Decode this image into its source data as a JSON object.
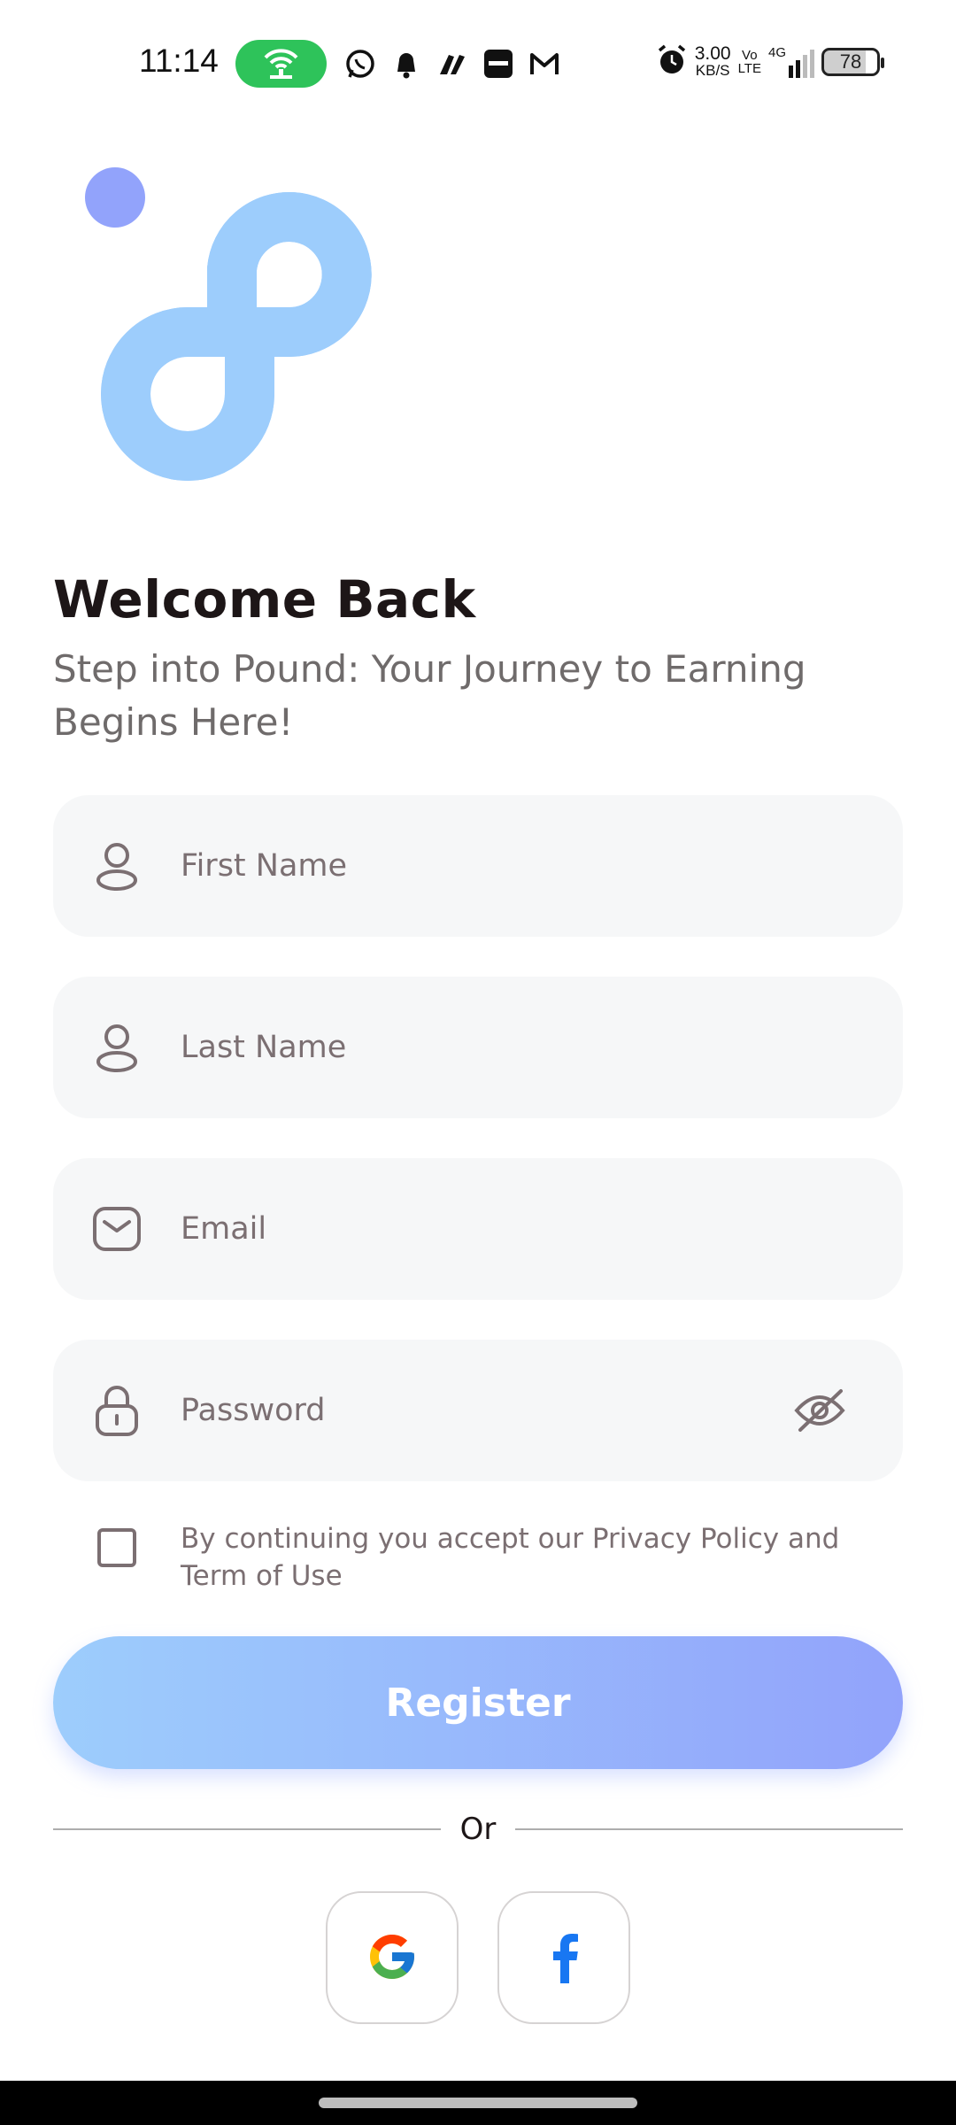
{
  "status_bar": {
    "time": "11:14",
    "net_speed_value": "3.00",
    "net_speed_unit": "KB/S",
    "volte_top": "Vo",
    "volte_bottom": "LTE",
    "network": "4G",
    "battery": "78",
    "icons": [
      "hotspot-icon",
      "whatsapp-icon",
      "bell-icon",
      "phonepe-icon",
      "paytm-icon",
      "gmail-icon",
      "alarm-icon",
      "signal-icon"
    ]
  },
  "header": {
    "title": "Welcome Back",
    "subtitle": "Step into Pound: Your Journey to Earning Begins Here!"
  },
  "form": {
    "first_name": {
      "placeholder": "First Name",
      "value": ""
    },
    "last_name": {
      "placeholder": "Last Name",
      "value": ""
    },
    "email": {
      "placeholder": "Email",
      "value": ""
    },
    "password": {
      "placeholder": "Password",
      "value": ""
    },
    "consent_text": "By continuing you accept our Privacy Policy and Term of Use",
    "consent_checked": false
  },
  "actions": {
    "register_label": "Register",
    "or_label": "Or"
  },
  "social": [
    {
      "name": "google",
      "icon": "google-icon"
    },
    {
      "name": "facebook",
      "icon": "facebook-icon"
    }
  ],
  "colors": {
    "gradient_start": "#9dcdfc",
    "gradient_end": "#92a3fb",
    "logo_blue": "#9dcdfc",
    "logo_dot": "#92a3fb",
    "facebook_blue": "#1877f2"
  }
}
